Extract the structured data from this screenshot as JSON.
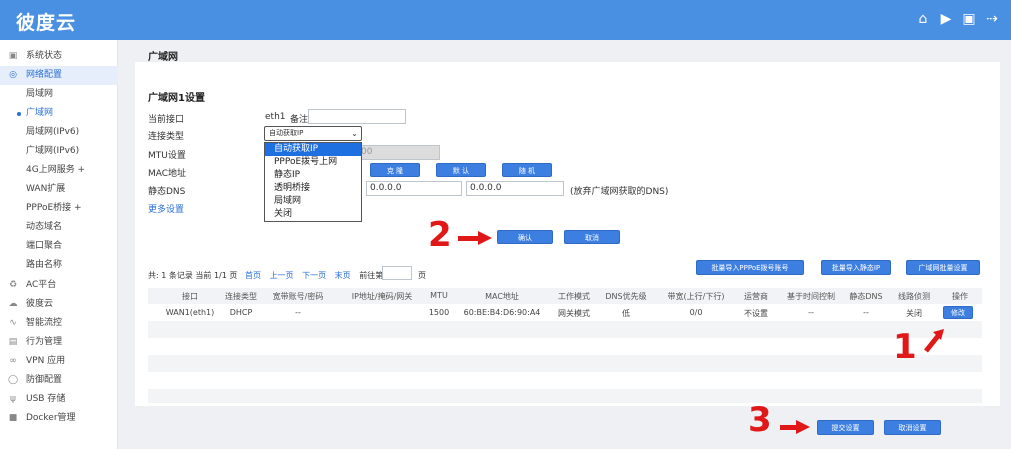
{
  "header": {
    "logo_text": "彼度云",
    "icons": [
      "home-icon",
      "play-circle-icon",
      "screen-icon",
      "logout-icon"
    ]
  },
  "sidebar": {
    "items": [
      {
        "label": "系统状态",
        "icon": "monitor-icon"
      },
      {
        "label": "网络配置",
        "icon": "globe-icon",
        "active": true
      },
      {
        "label": "局域网",
        "sub": true
      },
      {
        "label": "广域网",
        "sub": true,
        "current": true
      },
      {
        "label": "局域网(IPv6)",
        "sub": true
      },
      {
        "label": "广域网(IPv6)",
        "sub": true
      },
      {
        "label": "4G上网服务 +",
        "sub": true
      },
      {
        "label": "WAN扩展",
        "sub": true
      },
      {
        "label": "PPPoE桥接 +",
        "sub": true
      },
      {
        "label": "动态域名",
        "sub": true
      },
      {
        "label": "端口聚合",
        "sub": true
      },
      {
        "label": "路由名称",
        "sub": true
      },
      {
        "label": "AC平台",
        "icon": "ac-icon"
      },
      {
        "label": "彼度云",
        "icon": "cloud-icon"
      },
      {
        "label": "智能流控",
        "icon": "chart-icon"
      },
      {
        "label": "行为管理",
        "icon": "behavior-icon"
      },
      {
        "label": "VPN 应用",
        "icon": "vpn-icon"
      },
      {
        "label": "防御配置",
        "icon": "shield-icon"
      },
      {
        "label": "USB 存储",
        "icon": "usb-icon"
      },
      {
        "label": "Docker管理",
        "icon": "docker-icon"
      }
    ]
  },
  "page": {
    "title": "广域网",
    "section_title": "广域网1设置"
  },
  "form": {
    "current_iface_label": "当前接口",
    "current_iface_value": "eth1",
    "remark_label": "备注",
    "remark_value": "",
    "conn_type_label": "连接类型",
    "conn_type_value": "自动获取IP",
    "conn_type_options": [
      "自动获取IP",
      "PPPoE拨号上网",
      "静态IP",
      "透明桥接",
      "局域网",
      "关闭"
    ],
    "mtu_label": "MTU设置",
    "mtu_value": "00",
    "mac_label": "MAC地址",
    "mac_buttons": [
      "克 隆",
      "默 认",
      "随 机"
    ],
    "dns_label": "静态DNS",
    "dns1": "0.0.0.0",
    "dns2": "0.0.0.0",
    "dns_note": "(放弃广域网获取的DNS)",
    "more_settings": "更多设置",
    "confirm": "确认",
    "cancel": "取消"
  },
  "pager": {
    "summary": "共: 1 条记录 当前 1/1 页",
    "first": "首页",
    "prev": "上一页",
    "next": "下一页",
    "last": "末页",
    "goto_before": "前往第",
    "goto_after": "页"
  },
  "actions": {
    "batch_pppoe": "批量导入PPPoE拨号账号",
    "batch_static": "批量导入静态IP",
    "batch_wan": "广域网批量设置"
  },
  "table": {
    "headers": [
      "接口",
      "连接类型",
      "宽带账号/密码",
      "IP地址/掩码/网关",
      "MTU",
      "MAC地址",
      "工作模式",
      "DNS优先级",
      "带宽(上行/下行)",
      "运营商",
      "基于时间控制",
      "静态DNS",
      "线路侦测",
      "操作"
    ],
    "rows": [
      [
        "WAN1(eth1)",
        "DHCP",
        "--",
        "",
        "1500",
        "60:BE:B4:D6:90:A4",
        "网关模式",
        "低",
        "0/0",
        "不设置",
        "--",
        "--",
        "关闭",
        "修改"
      ]
    ]
  },
  "footer": {
    "submit": "提交设置",
    "cancel_settings": "取消设置"
  },
  "annotations": [
    "1",
    "2",
    "3"
  ],
  "colors": {
    "primary": "#4a90e2",
    "button": "#3d7fe0",
    "annotation": "#e01818",
    "dropdown_selected": "#1e6fe0"
  }
}
